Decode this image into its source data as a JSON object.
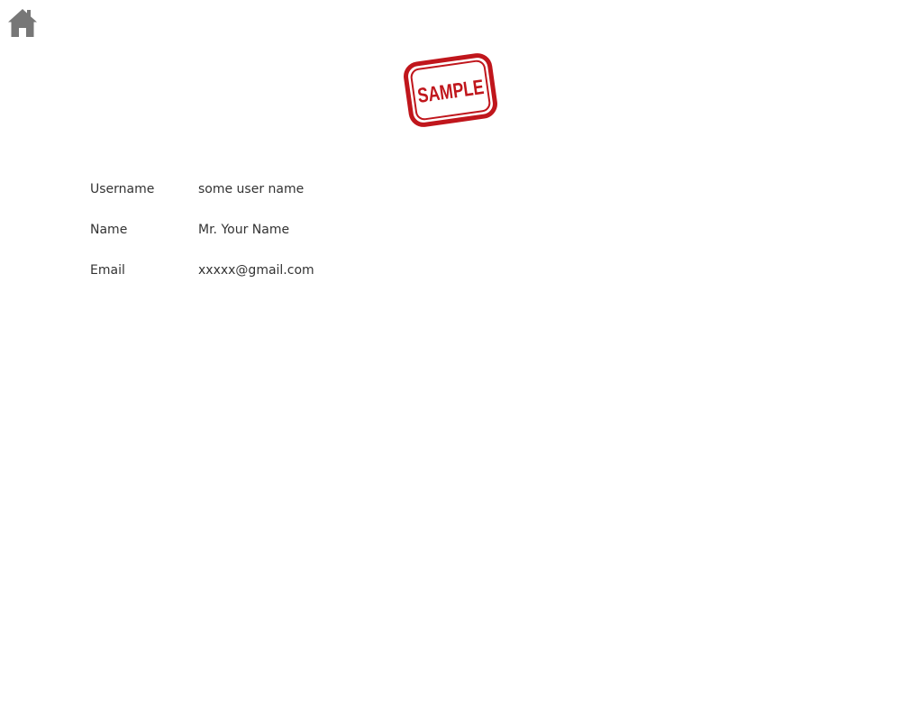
{
  "header": {
    "home_icon": "home-icon",
    "home_icon_color": "#777777"
  },
  "logo": {
    "stamp_text": "SAMPLE",
    "stamp_color": "#c0161c"
  },
  "profile": {
    "username_label": "Username",
    "username_value": "some user name",
    "name_label": "Name",
    "name_value": "Mr. Your Name",
    "email_label": "Email",
    "email_value": "xxxxx@gmail.com"
  }
}
